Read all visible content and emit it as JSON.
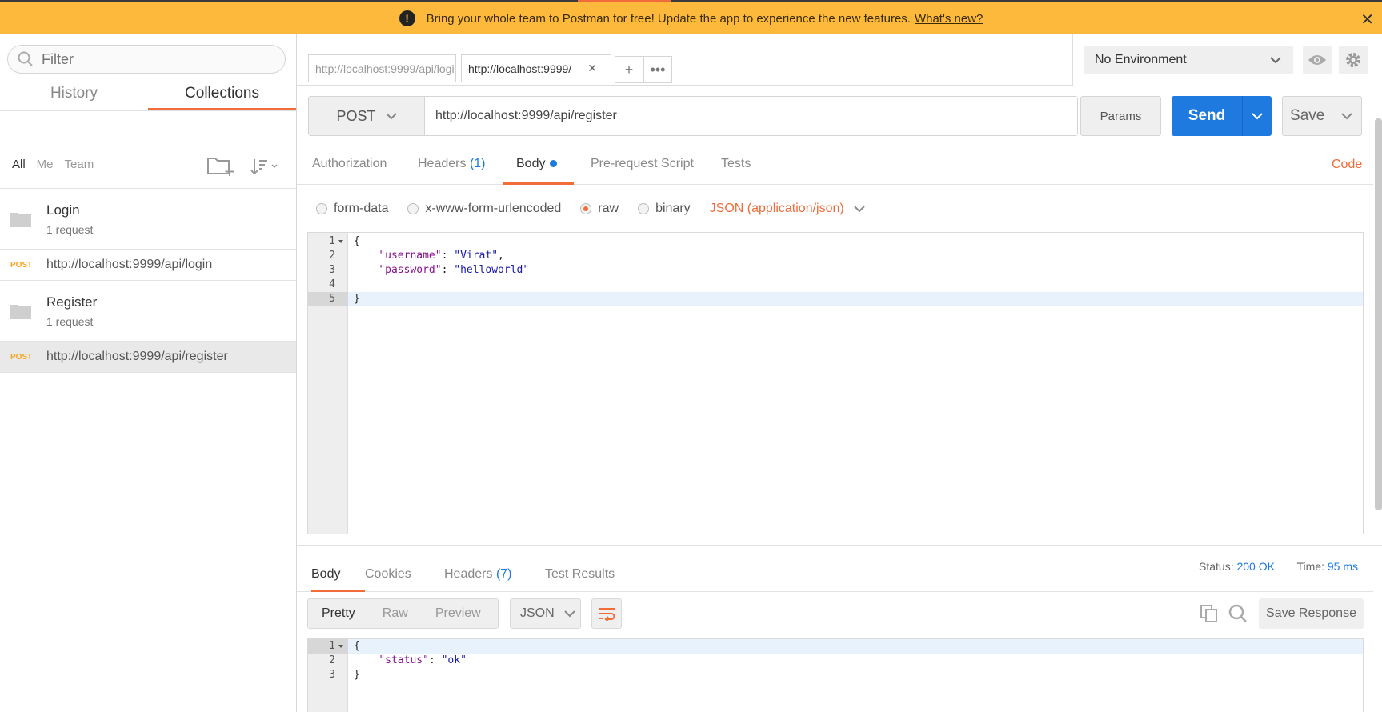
{
  "banner": {
    "message": "Bring your whole team to Postman for free! Update the app to experience the new features.",
    "link": "What's new?",
    "color": "#fdb93c"
  },
  "sidebar": {
    "filter_placeholder": "Filter",
    "tabs": [
      "History",
      "Collections"
    ],
    "active_tab": "Collections",
    "filter_options": [
      "All",
      "Me",
      "Team"
    ],
    "collections": [
      {
        "name": "Login",
        "count": "1 request",
        "requests": [
          {
            "method": "POST",
            "url": "http://localhost:9999/api/login"
          }
        ]
      },
      {
        "name": "Register",
        "count": "1 request",
        "requests": [
          {
            "method": "POST",
            "url": "http://localhost:9999/api/register"
          }
        ]
      }
    ]
  },
  "tabs": {
    "items": [
      {
        "label": "http://localhost:9999/api/login"
      },
      {
        "label": "http://localhost:9999/"
      }
    ]
  },
  "environment": {
    "selected": "No Environment"
  },
  "request": {
    "method": "POST",
    "url": "http://localhost:9999/api/register",
    "params_label": "Params",
    "send_label": "Send",
    "save_label": "Save",
    "tabs": [
      {
        "label": "Authorization"
      },
      {
        "label": "Headers",
        "count": "(1)"
      },
      {
        "label": "Body"
      },
      {
        "label": "Pre-request Script"
      },
      {
        "label": "Tests"
      }
    ],
    "active_tab": "Body",
    "code_label": "Code",
    "body_modes": [
      "form-data",
      "x-www-form-urlencoded",
      "raw",
      "binary"
    ],
    "selected_mode": "raw",
    "content_type": "JSON (application/json)",
    "body_lines": [
      "{",
      "    \"username\": \"Virat\",",
      "    \"password\": \"helloworld\"",
      "",
      "}"
    ]
  },
  "response": {
    "tabs": [
      {
        "label": "Body"
      },
      {
        "label": "Cookies"
      },
      {
        "label": "Headers",
        "count": "(7)"
      },
      {
        "label": "Test Results"
      }
    ],
    "active_tab": "Body",
    "status_label": "Status:",
    "status_value": "200 OK",
    "time_label": "Time:",
    "time_value": "95 ms",
    "views": [
      "Pretty",
      "Raw",
      "Preview"
    ],
    "active_view": "Pretty",
    "format": "JSON",
    "save_label": "Save Response",
    "body_lines": [
      "{",
      "    \"status\": \"ok\"",
      "}"
    ]
  },
  "colors": {
    "accent": "#f26b3a",
    "primary": "#1f7ae0",
    "method_post": "#f5a623"
  }
}
